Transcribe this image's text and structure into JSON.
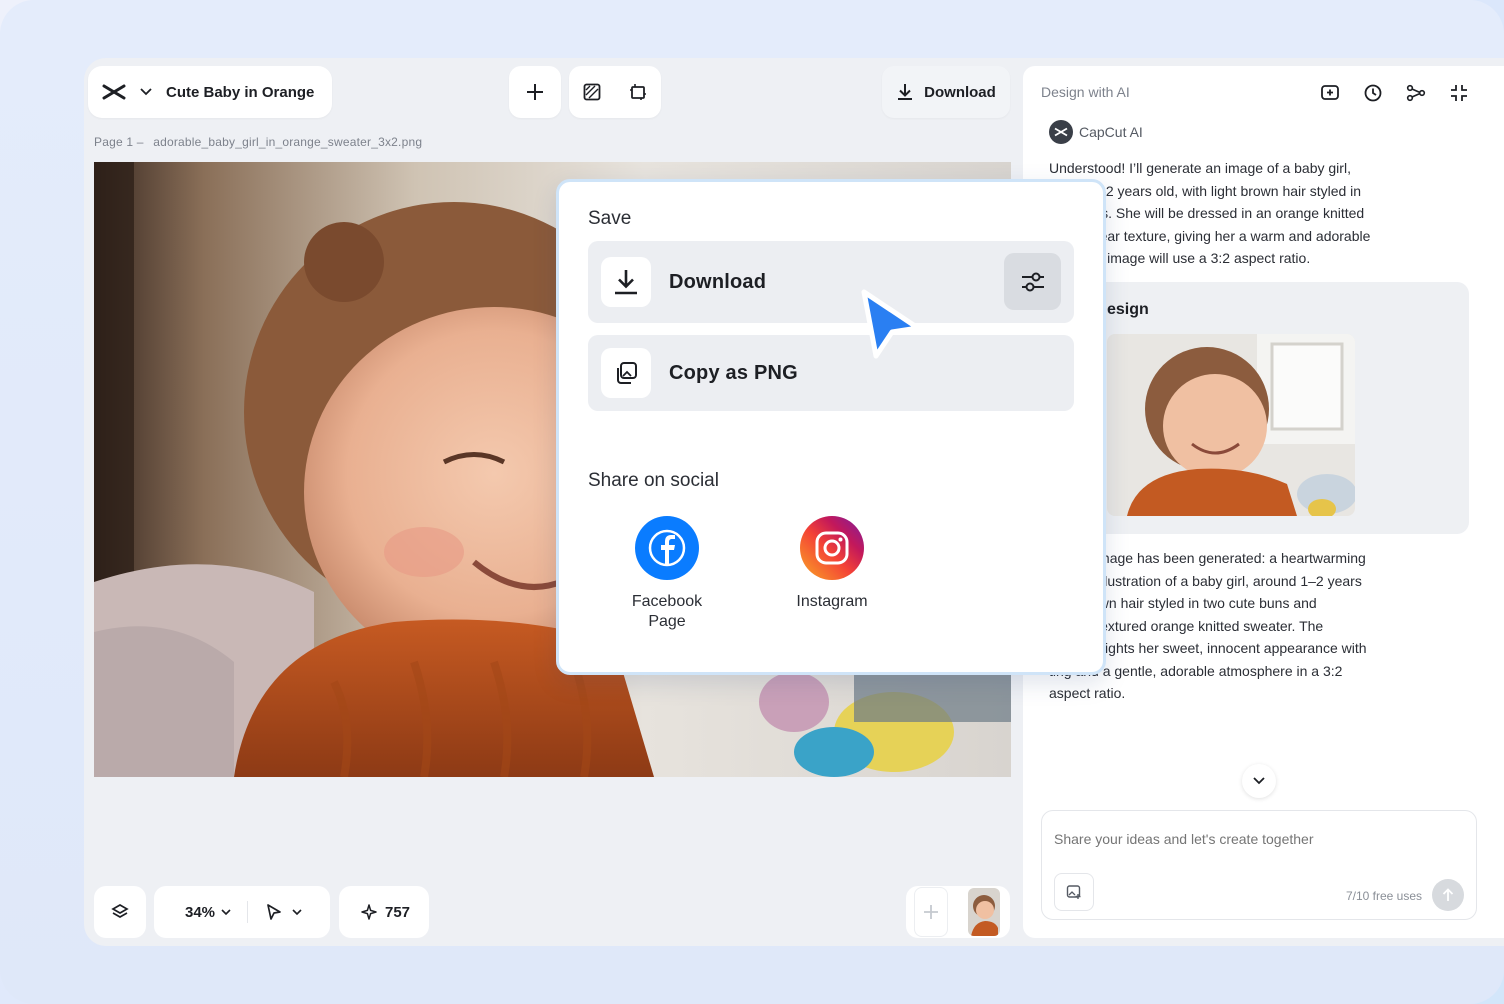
{
  "header": {
    "doc_title": "Cute Baby in Orange",
    "page_label": "Page 1 –",
    "file_name": "adorable_baby_girl_in_orange_sweater_3x2.png",
    "download_label": "Download"
  },
  "dialog": {
    "save_title": "Save",
    "download_label": "Download",
    "copy_label": "Copy as PNG",
    "share_title": "Share on social",
    "social": [
      {
        "line1": "Facebook",
        "line2": "Page"
      },
      {
        "line1": "Instagram",
        "line2": ""
      }
    ]
  },
  "panel": {
    "title": "Design with AI",
    "ai_name": "CapCut AI",
    "message1": [
      "Understood! I’ll generate an image of a baby girl,",
      "nately 1–2 years old, with light brown hair styled in",
      " little buns. She will be dressed in an orange knitted",
      "with a clear texture, giving her a warm and adorable",
      "nce. The image will use a 3:2 aspect ratio."
    ],
    "design_label": "esign",
    "message2": [
      "uested image has been generated: a heartwarming",
      "-quality illustration of a baby girl, around 1–2 years",
      " light brown hair styled in two cute buns and",
      "a cozy, textured orange knitted sweater. The",
      "tion highlights her sweet, innocent appearance with",
      "ting and a gentle, adorable atmosphere in a 3:2",
      "aspect ratio."
    ],
    "prompt_placeholder": "Share your ideas and let's create together",
    "free_uses": "7/10 free uses"
  },
  "toolbar": {
    "zoom": "34%",
    "credits": "757"
  },
  "colors": {
    "accent": "#2f7ff4",
    "facebook": "#0a7cff",
    "cursor": "#2a7ff2"
  }
}
